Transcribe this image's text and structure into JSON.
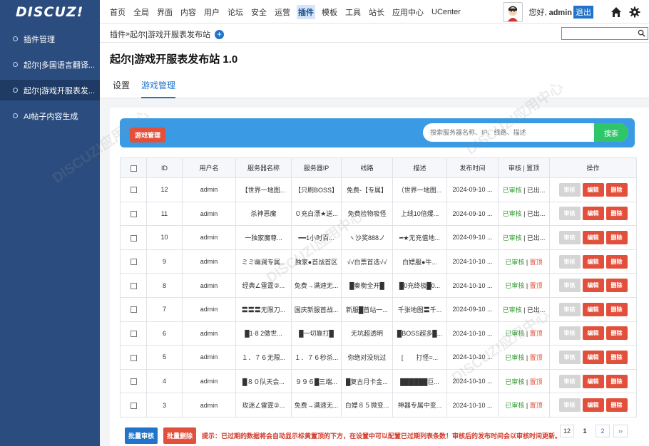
{
  "brand": {
    "logo_text": "DISCUZ!"
  },
  "topnav": [
    {
      "label": "首页",
      "active": false
    },
    {
      "label": "全局",
      "active": false
    },
    {
      "label": "界面",
      "active": false
    },
    {
      "label": "内容",
      "active": false
    },
    {
      "label": "用户",
      "active": false
    },
    {
      "label": "论坛",
      "active": false
    },
    {
      "label": "安全",
      "active": false
    },
    {
      "label": "运营",
      "active": false
    },
    {
      "label": "插件",
      "active": true
    },
    {
      "label": "模板",
      "active": false
    },
    {
      "label": "工具",
      "active": false
    },
    {
      "label": "站长",
      "active": false
    },
    {
      "label": "应用中心",
      "active": false
    },
    {
      "label": "UCenter",
      "active": false
    }
  ],
  "user": {
    "greeting": "您好,",
    "name": "admin",
    "logout": "退出"
  },
  "icons": {
    "home": "home-icon",
    "settings": "gear-icon",
    "search": "search-icon",
    "plus": "plus-icon"
  },
  "sidebar": {
    "items": [
      {
        "label": "插件管理"
      },
      {
        "label": "起尔|多国语言翻译..."
      },
      {
        "label": "起尔|游戏开服表发..."
      },
      {
        "label": "AI帖子内容生成"
      }
    ]
  },
  "breadcrumb": {
    "root": "插件",
    "sep": " » ",
    "current": "起尔|游戏开服表发布站"
  },
  "page": {
    "title": "起尔|游戏开服表发布站 1.0"
  },
  "tabs": [
    {
      "label": "设置"
    },
    {
      "label": "游戏管理"
    }
  ],
  "toolbar": {
    "tag": "游戏管理",
    "search_placeholder": "搜索服务器名称、IP、线路、描述",
    "search_button": "搜索"
  },
  "table": {
    "headers": [
      "",
      "ID",
      "用户名",
      "服务器名称",
      "服务器IP",
      "线路",
      "描述",
      "发布时间",
      "审核 | 置顶",
      "操作"
    ],
    "status_approved": "已审核",
    "status_sep": " | ",
    "op_review": "审核",
    "op_edit": "编辑",
    "op_delete": "删除",
    "rows": [
      {
        "id": "12",
        "user": "admin",
        "name": "【世界一地图...",
        "ip": "【只刷BOSS】",
        "line": "免费-【专属】",
        "desc": "（世界一地图...",
        "time": "2024-09-10 ...",
        "pin": "已出...",
        "pinned": false
      },
      {
        "id": "11",
        "user": "admin",
        "name": "杀神恶魔",
        "ip": "０充白漂★送...",
        "line": "免费捡物吸怪",
        "desc": "上线10倍爆...",
        "time": "2024-09-10 ...",
        "pin": "已出...",
        "pinned": false
      },
      {
        "id": "10",
        "user": "admin",
        "name": "一独家魔尊...",
        "ip": "━━1小时百...",
        "line": "ヽ沙奖888ノ",
        "desc": "━★无充值地...",
        "time": "2024-09-10 ...",
        "pin": "已出...",
        "pinned": false
      },
      {
        "id": "9",
        "user": "admin",
        "name": "ミミ幽澜专属...",
        "ip": "独家●首战首区",
        "line": "√√白票首选√√",
        "desc": "白嫖服●牛...",
        "time": "2024-10-10 ...",
        "pin": "置顶",
        "pinned": true
      },
      {
        "id": "8",
        "user": "admin",
        "name": "经典∠雷霆②...",
        "ip": "免费→满速无...",
        "line": "█秦衡全开█",
        "desc": "█0充终极█0...",
        "time": "2024-10-10 ...",
        "pin": "置顶",
        "pinned": true
      },
      {
        "id": "7",
        "user": "admin",
        "name": "〓〓〓无限刀...",
        "ip": "国庆新服首战...",
        "line": "新服█首站一...",
        "desc": "千张地图〓千...",
        "time": "2024-09-10 ...",
        "pin": "已出...",
        "pinned": false
      },
      {
        "id": "6",
        "user": "admin",
        "name": "█1·8 2傲世...",
        "ip": "█一切靠打█",
        "line": "无坑超透明",
        "desc": "█BOSS超多█...",
        "time": "2024-10-10 ...",
        "pin": "置顶",
        "pinned": true
      },
      {
        "id": "5",
        "user": "admin",
        "name": "１．７６无限...",
        "ip": "１．７６秒杀...",
        "line": "你绝对没玩过",
        "desc": "[　　打怪=...",
        "time": "2024-10-10 ...",
        "pin": "置顶",
        "pinned": true
      },
      {
        "id": "4",
        "user": "admin",
        "name": "█８０队天会...",
        "ip": "９９６█三端...",
        "line": "█复古月卡金...",
        "desc": "██████巨...",
        "time": "2024-10-10 ...",
        "pin": "置顶",
        "pinned": true
      },
      {
        "id": "3",
        "user": "admin",
        "name": "玫迷∠雷霆②...",
        "ip": "免费→满速无...",
        "line": "白嫖８５微变...",
        "desc": "神器专属中变...",
        "time": "2024-10-10 ...",
        "pin": "置顶",
        "pinned": true
      }
    ]
  },
  "footer": {
    "batch_approve": "批量审核",
    "batch_delete": "批量删除",
    "hint": "提示：已过期的数据将会自动显示标黄置顶的下方，在设置中可以配置已过期列表条数！审核后的发布时间会以审核时间更新。"
  },
  "pager": [
    {
      "label": "12"
    },
    {
      "label": "1"
    },
    {
      "label": "2"
    },
    {
      "label": "››"
    }
  ],
  "colors": {
    "sidebar": "#2b4c7e",
    "accent": "#2274c9",
    "danger": "#e24f3b",
    "success": "#2fc66a",
    "searchbar": "#3a9ae3"
  }
}
